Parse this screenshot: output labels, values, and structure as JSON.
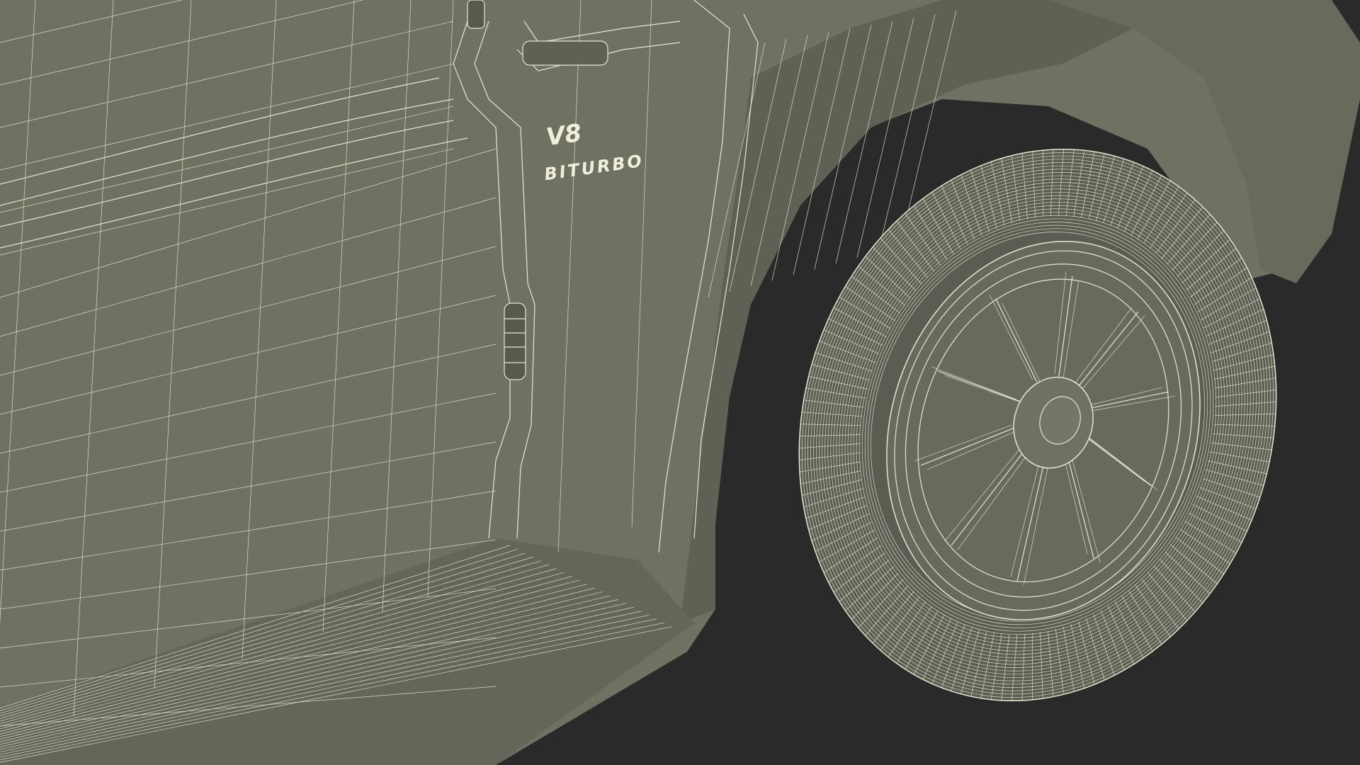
{
  "scene": {
    "badge_model": "V8",
    "badge_engine": "BITURBO"
  },
  "colors": {
    "background": "#2a2a2a",
    "body_panel": "#6f7162",
    "body_panel_dark": "#5f6154",
    "wire": "#e8e6cf",
    "tire": "#5b5d52",
    "rim": "#676a5c"
  }
}
